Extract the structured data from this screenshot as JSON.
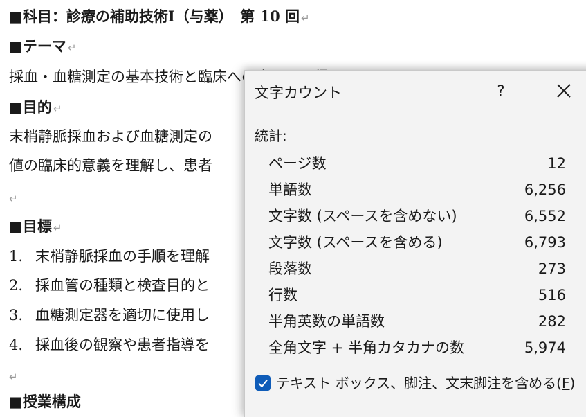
{
  "document": {
    "title": "■科目：診療の補助技術Ⅰ（与薬）　第 10 回",
    "theme_heading": "■テーマ",
    "theme_text": "採血・血糖測定の基本技術と臨床への応用と習得",
    "purpose_heading": "■目的",
    "purpose_line1": "末梢静脈採血および血糖測定の",
    "purpose_line2": "値の臨床的意義を理解し、患者",
    "goals_heading": "■目標",
    "goals": [
      {
        "num": "1.",
        "text": "末梢静脈採血の手順を理解"
      },
      {
        "num": "2.",
        "text": "採血管の種類と検査目的と"
      },
      {
        "num": "3.",
        "text": "血糖測定器を適切に使用し"
      },
      {
        "num": "4.",
        "text": "採血後の観察や患者指導を"
      }
    ],
    "bottom_partial": "■授業構成",
    "para_mark": "↵"
  },
  "dialog": {
    "title": "文字カウント",
    "help_label": "?",
    "stats_label": "統計:",
    "stats": [
      {
        "label": "ページ数",
        "value": "12"
      },
      {
        "label": "単語数",
        "value": "6,256"
      },
      {
        "label": "文字数 (スペースを含めない)",
        "value": "6,552"
      },
      {
        "label": "文字数 (スペースを含める)",
        "value": "6,793"
      },
      {
        "label": "段落数",
        "value": "273"
      },
      {
        "label": "行数",
        "value": "516"
      },
      {
        "label": "半角英数の単語数",
        "value": "282"
      },
      {
        "label": "全角文字 + 半角カタカナの数",
        "value": "5,974"
      }
    ],
    "checkbox_label": "テキスト ボックス、脚注、文末脚注を含める(",
    "checkbox_accel": "F",
    "checkbox_close": ")",
    "checkbox_checked": true,
    "accent_color": "#0f5cb8"
  }
}
